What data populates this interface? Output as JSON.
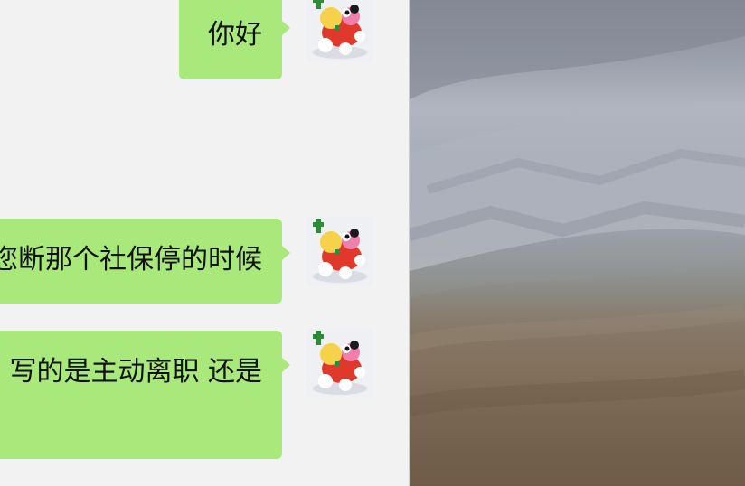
{
  "chat": {
    "messages": [
      {
        "text": "你好"
      },
      {
        "text": "咨询一下公司给您断那个社保停的时候"
      },
      {
        "text": "写的是主动离职 还是"
      }
    ],
    "avatar_icon": "cartoon-toy-dog-avatar"
  },
  "colors": {
    "bubble": "#a9e97b",
    "chat_bg": "#f2f2f2"
  }
}
